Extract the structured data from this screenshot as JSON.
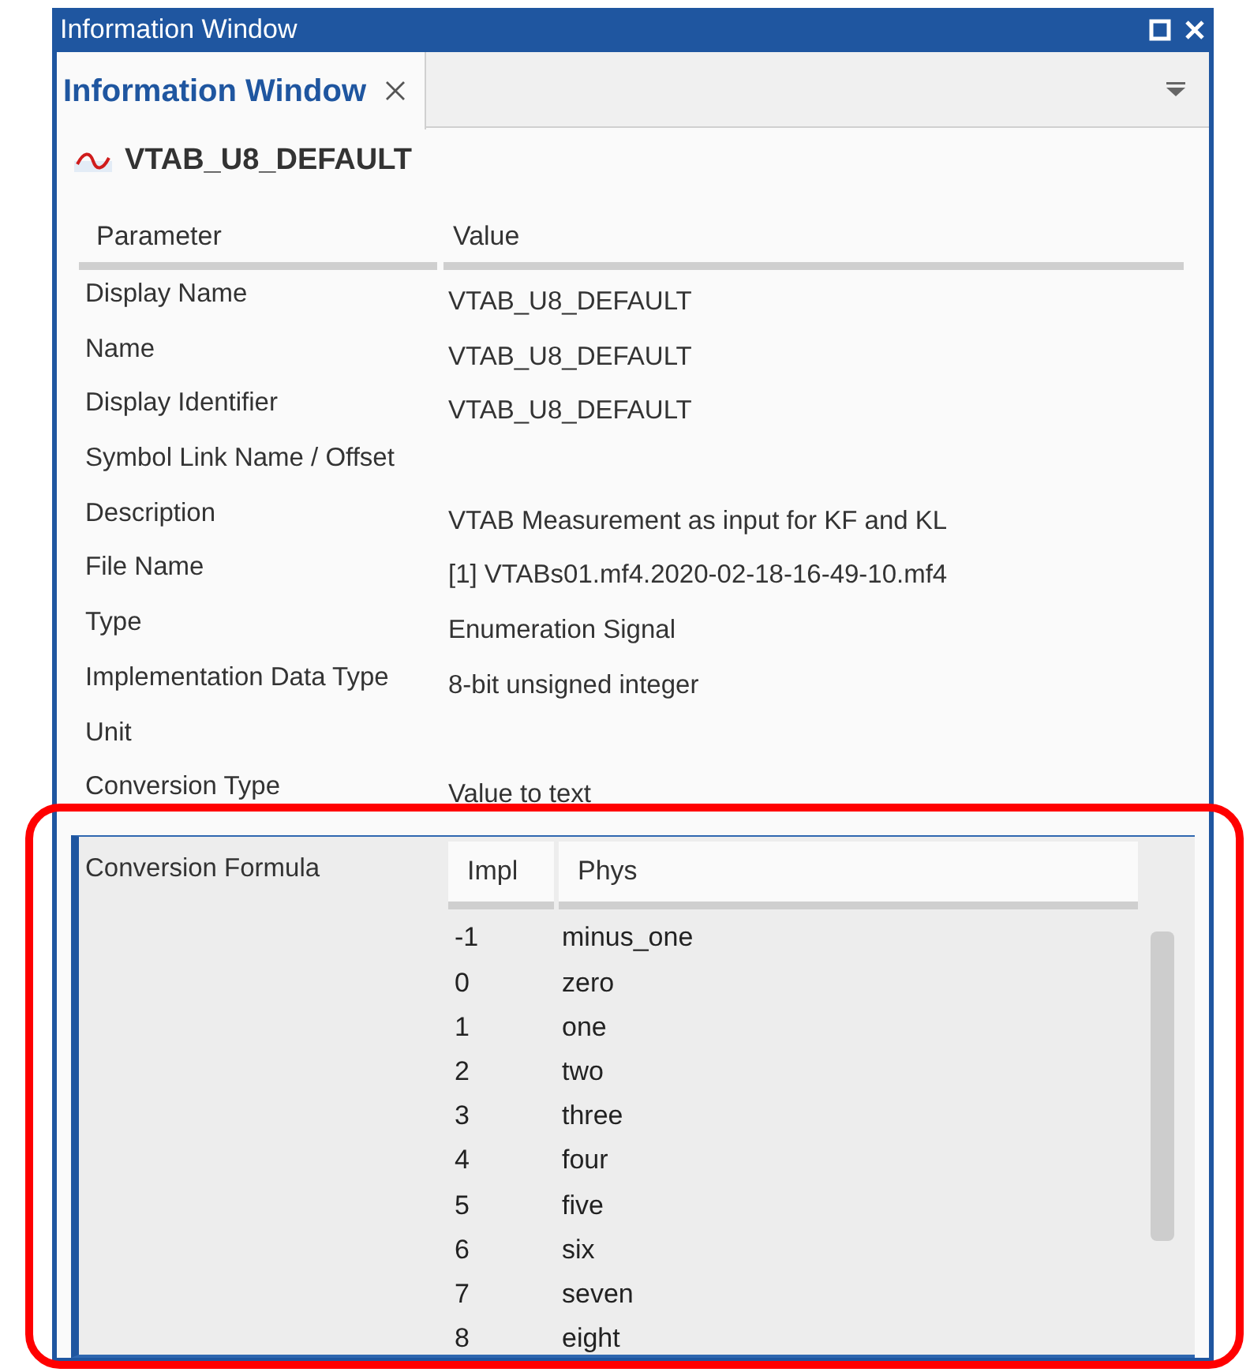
{
  "window": {
    "title": "Information Window"
  },
  "tabs": [
    {
      "label": "Information Window",
      "selected": true
    }
  ],
  "signal": {
    "name": "VTAB_U8_DEFAULT"
  },
  "table": {
    "columns": [
      "Parameter",
      "Value"
    ],
    "rows": [
      {
        "parameter": "Display Name",
        "value": "VTAB_U8_DEFAULT"
      },
      {
        "parameter": "Name",
        "value": "VTAB_U8_DEFAULT"
      },
      {
        "parameter": "Display Identifier",
        "value": "VTAB_U8_DEFAULT"
      },
      {
        "parameter": "Symbol Link Name / Offset",
        "value": ""
      },
      {
        "parameter": "Description",
        "value": "VTAB Measurement as input for KF and KL"
      },
      {
        "parameter": "File Name",
        "value": "[1] VTABs01.mf4.2020-02-18-16-49-10.mf4"
      },
      {
        "parameter": "Type",
        "value": "Enumeration Signal"
      },
      {
        "parameter": "Implementation Data Type",
        "value": "8-bit unsigned integer"
      },
      {
        "parameter": "Unit",
        "value": ""
      },
      {
        "parameter": "Conversion Type",
        "value": "Value to text"
      }
    ]
  },
  "conversion_formula": {
    "label": "Conversion Formula",
    "columns": [
      "Impl",
      "Phys"
    ],
    "rows": [
      {
        "impl": "-1",
        "phys": "minus_one"
      },
      {
        "impl": "0",
        "phys": "zero"
      },
      {
        "impl": "1",
        "phys": "one"
      },
      {
        "impl": "2",
        "phys": "two"
      },
      {
        "impl": "3",
        "phys": "three"
      },
      {
        "impl": "4",
        "phys": "four"
      },
      {
        "impl": "5",
        "phys": "five"
      },
      {
        "impl": "6",
        "phys": "six"
      },
      {
        "impl": "7",
        "phys": "seven"
      },
      {
        "impl": "8",
        "phys": "eight"
      }
    ]
  }
}
